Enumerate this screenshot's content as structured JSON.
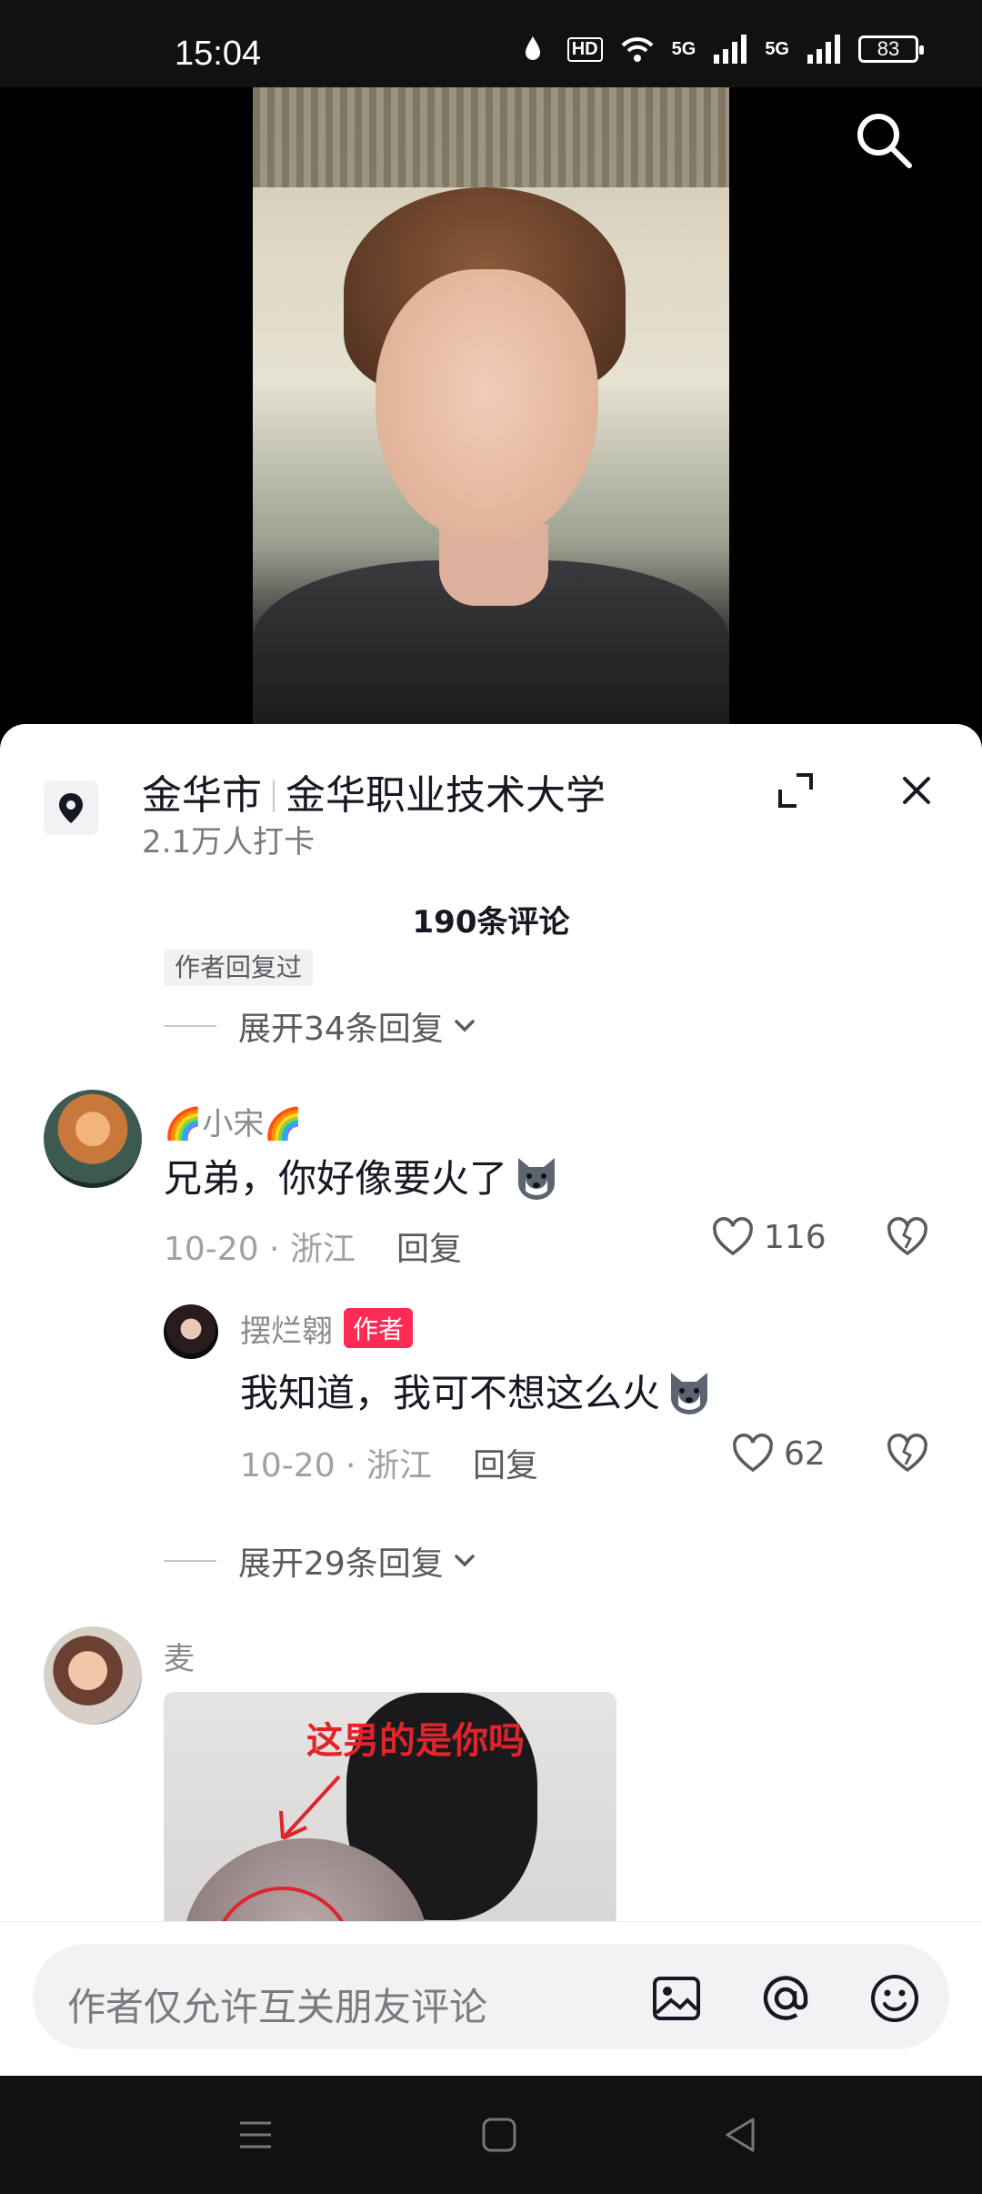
{
  "status_bar": {
    "time": "15:04",
    "hd_label": "HD",
    "net1": "5G",
    "net2": "5G",
    "battery": "83"
  },
  "location": {
    "city": "金华市",
    "place": "金华职业技术大学",
    "checkins": "2.1万人打卡"
  },
  "comments_header": {
    "count": "190条评论",
    "author_replied_tag": "作者回复过",
    "expand_first": "展开34条回复"
  },
  "comments": [
    {
      "user": "🌈小宋🌈",
      "text": "兄弟，你好像要火了",
      "meta": "10-20 · 浙江",
      "reply": "回复",
      "likes": "116",
      "reply_thread": {
        "user": "摆烂翱",
        "badge": "作者",
        "text": "我知道，我可不想这么火",
        "meta": "10-20 · 浙江",
        "reply": "回复",
        "likes": "62"
      },
      "expand": "展开29条回复"
    },
    {
      "user": "麦",
      "image_caption": "这男的是你吗"
    }
  ],
  "input": {
    "placeholder": "作者仅允许互关朋友评论"
  },
  "icons": {
    "search": "search-icon",
    "location": "location-pin-icon",
    "expand": "expand-icon",
    "close": "close-icon",
    "like": "heart-icon",
    "dislike": "broken-heart-icon",
    "image": "image-icon",
    "mention": "at-icon",
    "emoji": "emoji-icon"
  },
  "colors": {
    "accent": "#fe2c55",
    "text_primary": "#161823",
    "text_secondary": "#8a8a90"
  }
}
